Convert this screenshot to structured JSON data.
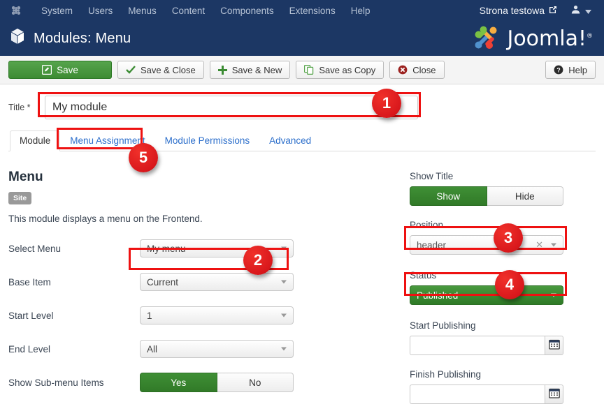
{
  "topbar": {
    "logo_icon": "joomla-logo-icon",
    "menu": [
      {
        "label": "System"
      },
      {
        "label": "Users"
      },
      {
        "label": "Menus"
      },
      {
        "label": "Content"
      },
      {
        "label": "Components"
      },
      {
        "label": "Extensions"
      },
      {
        "label": "Help"
      }
    ],
    "site_name": "Strona testowa",
    "site_link_icon": "external-link-icon",
    "user_icon": "user-icon",
    "user_caret_icon": "chevron-down-icon"
  },
  "header": {
    "icon": "cube-icon",
    "title": "Modules: Menu",
    "brand": "Joomla!",
    "brand_sup": "®",
    "brand_icon": "joomla-brand-icon"
  },
  "toolbar": {
    "save": {
      "label": "Save",
      "icon": "pencil-square-icon"
    },
    "save_close": {
      "label": "Save & Close",
      "icon": "check-icon"
    },
    "save_new": {
      "label": "Save & New",
      "icon": "plus-icon"
    },
    "save_copy": {
      "label": "Save as Copy",
      "icon": "copy-icon"
    },
    "close": {
      "label": "Close",
      "icon": "close-circle-icon"
    },
    "help": {
      "label": "Help",
      "icon": "question-circle-icon"
    }
  },
  "title_field": {
    "label": "Title *",
    "value": "My module",
    "placeholder": ""
  },
  "tabs": [
    {
      "label": "Module",
      "active": true
    },
    {
      "label": "Menu Assignment",
      "active": false
    },
    {
      "label": "Module Permissions",
      "active": false
    },
    {
      "label": "Advanced",
      "active": false
    }
  ],
  "main": {
    "module_name": "Menu",
    "badge": "Site",
    "description": "This module displays a menu on the Frontend.",
    "fields": [
      {
        "label": "Select Menu",
        "type": "select",
        "value": "My menu"
      },
      {
        "label": "Base Item",
        "type": "select",
        "value": "Current"
      },
      {
        "label": "Start Level",
        "type": "select",
        "value": "1"
      },
      {
        "label": "End Level",
        "type": "select",
        "value": "All"
      },
      {
        "label": "Show Sub-menu Items",
        "type": "toggle",
        "on": "Yes",
        "off": "No",
        "selected": "Yes"
      }
    ]
  },
  "sidebar": {
    "show_title": {
      "label": "Show Title",
      "on": "Show",
      "off": "Hide",
      "selected": "Show"
    },
    "position": {
      "label": "Position",
      "value": "header",
      "clear_icon": "clear-x-icon",
      "caret_icon": "chevron-down-icon"
    },
    "status": {
      "label": "Status",
      "value": "Published",
      "caret_icon": "chevron-down-icon"
    },
    "start_publishing": {
      "label": "Start Publishing",
      "value": "",
      "button_icon": "calendar-icon"
    },
    "finish_publishing": {
      "label": "Finish Publishing",
      "value": "",
      "button_icon": "calendar-icon"
    }
  },
  "annotations": {
    "markers": [
      {
        "number": "1",
        "target": "title-input"
      },
      {
        "number": "2",
        "target": "select-menu"
      },
      {
        "number": "3",
        "target": "position-field"
      },
      {
        "number": "4",
        "target": "status-field"
      },
      {
        "number": "5",
        "target": "menu-assignment-tab"
      }
    ],
    "highlight_color": "#ee1111"
  }
}
